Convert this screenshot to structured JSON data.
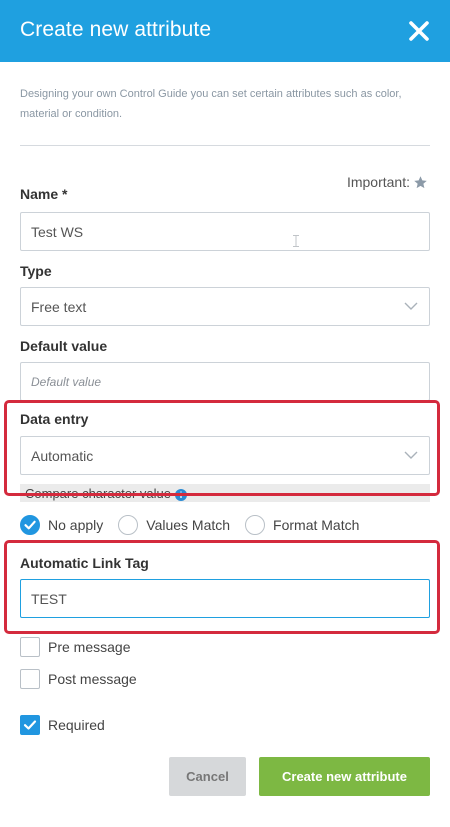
{
  "header": {
    "title": "Create new attribute",
    "close_icon": "close-icon"
  },
  "intro": {
    "text": "Designing your own Control Guide you can set certain attributes such as color, material or condition."
  },
  "important": {
    "label": "Important:",
    "icon": "star-icon"
  },
  "name": {
    "label": "Name *",
    "value": "Test WS"
  },
  "type": {
    "label": "Type",
    "value": "Free text"
  },
  "default_value": {
    "label": "Default value",
    "placeholder": "Default value"
  },
  "data_entry": {
    "label": "Data entry",
    "value": "Automatic"
  },
  "compare": {
    "label": "Compare character value",
    "options": [
      {
        "label": "No apply",
        "checked": true
      },
      {
        "label": "Values Match",
        "checked": false
      },
      {
        "label": "Format Match",
        "checked": false
      }
    ]
  },
  "link_tag": {
    "label": "Automatic Link Tag",
    "value": "TEST"
  },
  "checkboxes": {
    "pre_message": {
      "label": "Pre message",
      "checked": false
    },
    "post_message": {
      "label": "Post message",
      "checked": false
    },
    "required": {
      "label": "Required",
      "checked": true
    }
  },
  "buttons": {
    "cancel": "Cancel",
    "create": "Create new attribute"
  },
  "colors": {
    "header": "#1fa0e0",
    "accent": "#2196e0",
    "highlight": "#d42a3d",
    "create_button": "#7db843"
  }
}
